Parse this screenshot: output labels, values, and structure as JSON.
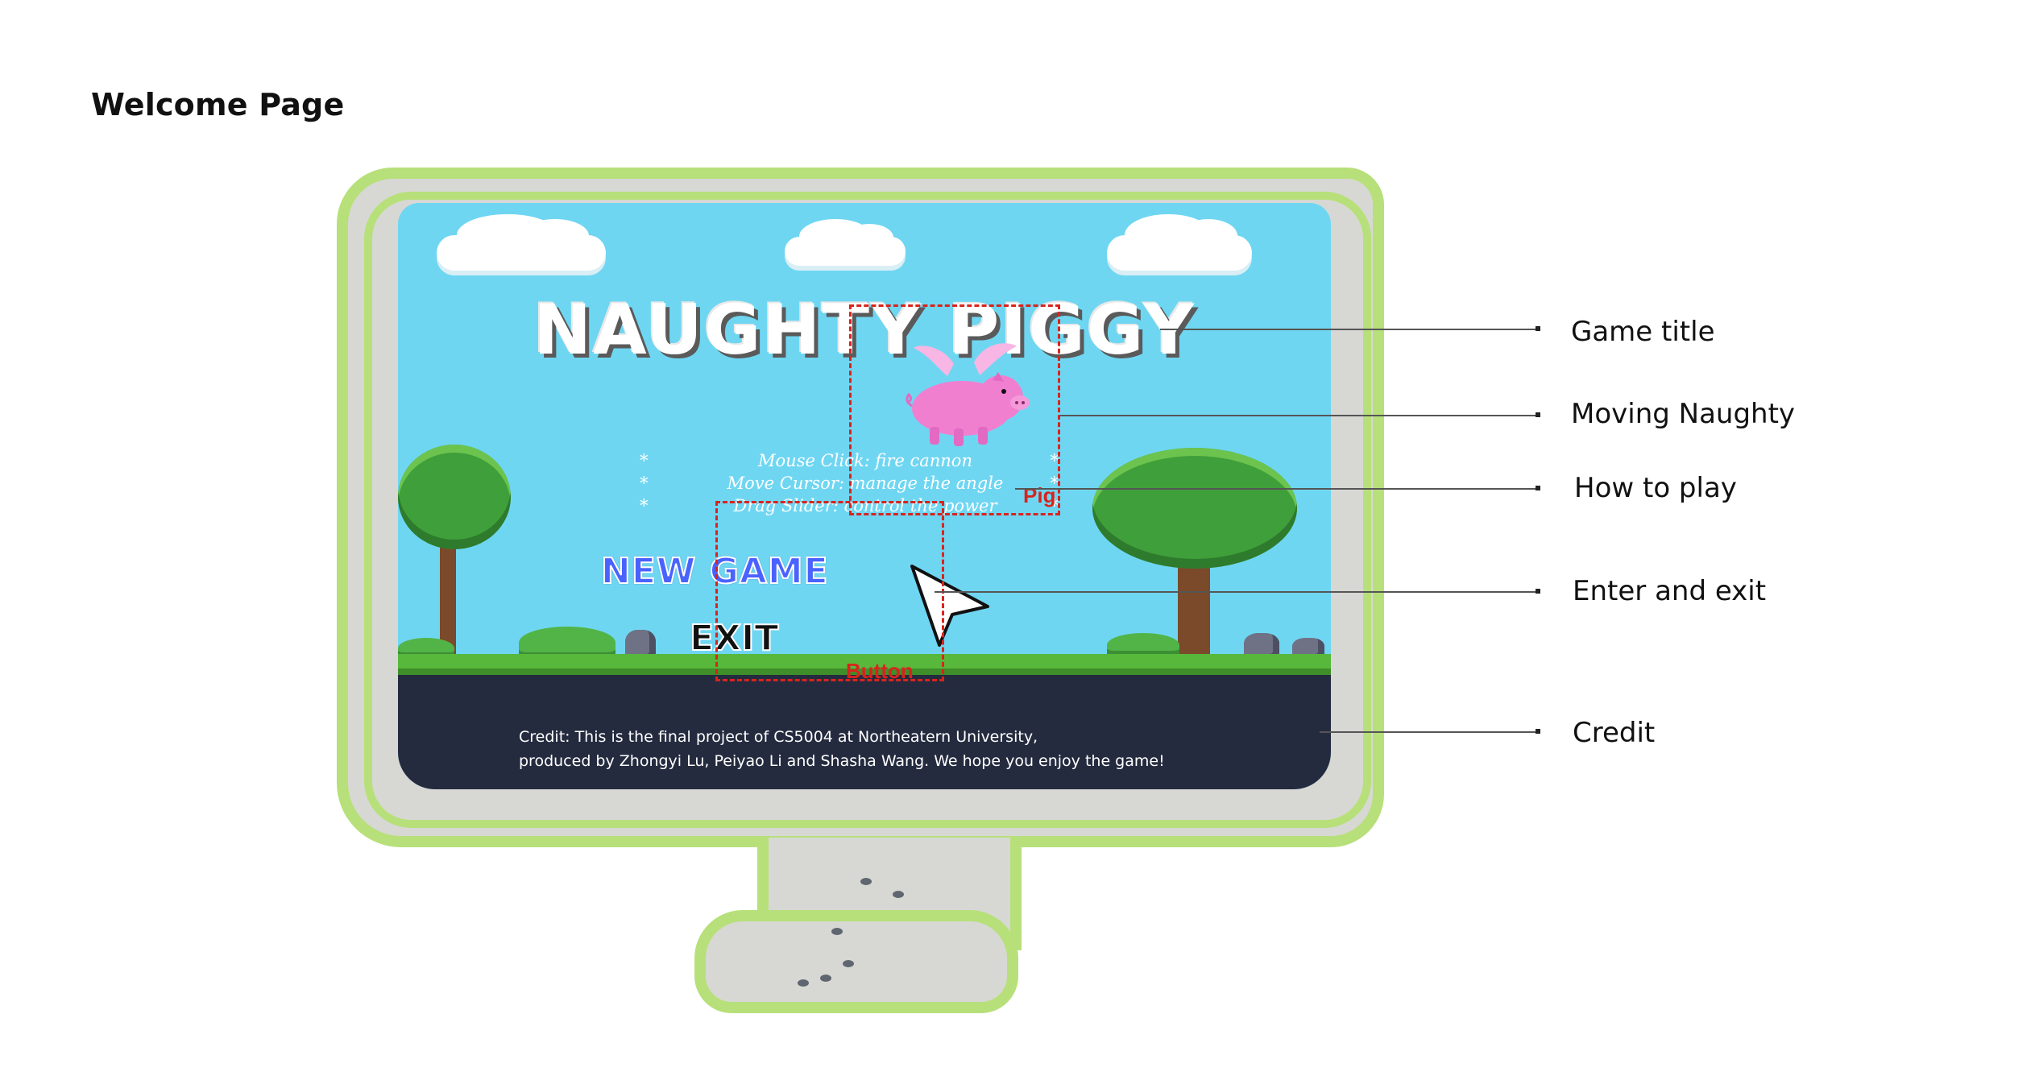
{
  "page": {
    "heading": "Welcome Page"
  },
  "game": {
    "title": "NAUGHTY PIGGY",
    "how_to_play": [
      {
        "star_left": "*",
        "text": "Mouse Click: fire cannon",
        "star_right": "*"
      },
      {
        "star_left": "*",
        "text": "Move Cursor: manage the angle",
        "star_right": "*"
      },
      {
        "star_left": "*",
        "text": "Drag Slider: control the power",
        "star_right": "*"
      }
    ],
    "buttons": {
      "new_game": "NEW GAME",
      "exit": "EXIT"
    },
    "credit_lines": [
      "Credit: This is the final project of CS5004 at Northeatern University,",
      "produced by Zhongyi Lu, Peiyao Li and Shasha Wang. We hope you enjoy the game!"
    ]
  },
  "annotations": {
    "pig_label": "Pig",
    "button_label": "Button"
  },
  "callouts": [
    {
      "label": "Game title"
    },
    {
      "label": "Moving Naughty"
    },
    {
      "label": "How to play"
    },
    {
      "label": "Enter and exit"
    },
    {
      "label": "Credit"
    }
  ],
  "colors": {
    "monitor_outline": "#b7e07a",
    "sky": "#6fd6f2",
    "annotation_red": "#d8241d",
    "new_game_blue": "#4a62ff",
    "pig_pink": "#f07fd0",
    "ground": "#252b3f"
  },
  "icons": {
    "cursor": "arrow-cursor-icon",
    "pig": "flying-pig-icon"
  }
}
